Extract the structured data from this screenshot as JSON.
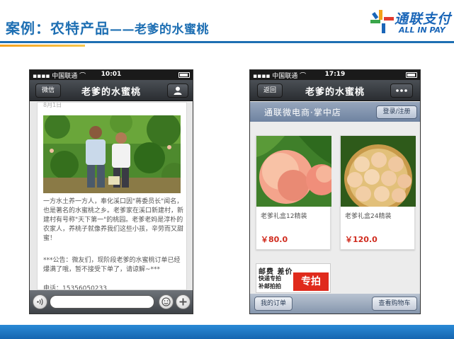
{
  "slide": {
    "title_prefix": "案例：农特产品",
    "title_dash": "——",
    "title_suffix": "老爹的水蜜桃"
  },
  "logo": {
    "brand": "通联支付",
    "sub": "ALL IN PAY"
  },
  "phone_left": {
    "status": {
      "carrier": "中国联通",
      "time": "10:01"
    },
    "nav": {
      "back_label": "微信",
      "title": "老爹的水蜜桃",
      "profile_icon": "person-icon"
    },
    "article": {
      "date": "8月1日",
      "body": "一方水土养一方人，奉化溪口因\"蒋委员长\"闻名，也是著名的水蜜桃之乡。老爹家在溪口新建村，新建村有号称\"天下第一\"的桃园。老爹老妈是淳朴的农家人，养桃子就像养我们这些小孩，辛劳而又甜蜜！",
      "notice": "***公告：微友们，现阶段老爹的水蜜桃订单已经爆满了哦，暂不接受下单了，请谅解~***",
      "phone": "电话：15356050233"
    },
    "input_bar": {
      "voice_icon": "voice-icon",
      "emoji_icon": "emoji-icon",
      "plus_icon": "plus-icon"
    }
  },
  "phone_right": {
    "status": {
      "carrier": "中国联通",
      "time": "17:19"
    },
    "nav": {
      "back_label": "返回",
      "title": "老爹的水蜜桃",
      "more_icon": "more-icon"
    },
    "store": {
      "name": "通联微电商·掌中店",
      "login_label": "登录/注册"
    },
    "products": [
      {
        "name": "老爹礼盒12精装",
        "price": "￥80.0"
      },
      {
        "name": "老爹礼盒24精装",
        "price": "￥120.0"
      }
    ],
    "promo": {
      "line1": "邮费 差价",
      "line2": "快递专拍",
      "line3": "补邮拍拍",
      "badge": "专拍"
    },
    "bottom": {
      "orders_label": "我的订单",
      "cart_label": "查看购物车"
    }
  },
  "colors": {
    "brand_blue": "#1e6fb3",
    "accent_orange": "#f7a11a",
    "price_red": "#d02b1e"
  }
}
